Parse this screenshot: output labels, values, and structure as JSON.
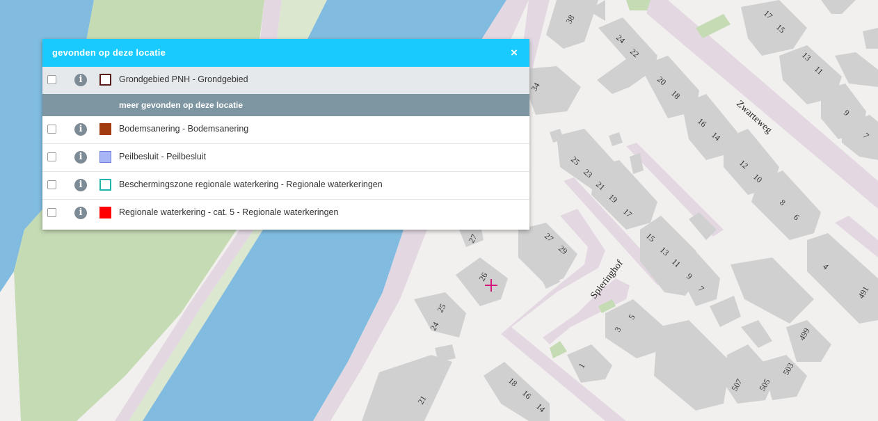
{
  "panel": {
    "title": "gevonden op deze locatie",
    "close_icon": "×",
    "primary": {
      "label": "Grondgebied PNH - Grondgebied",
      "swatch_fill": "#ffffff",
      "swatch_border": "#5a1a1a"
    },
    "more_header": "meer gevonden op deze locatie",
    "items": [
      {
        "label": "Bodemsanering - Bodemsanering",
        "swatch_fill": "#a23b10",
        "swatch_border": "#a23b10"
      },
      {
        "label": "Peilbesluit - Peilbesluit",
        "swatch_fill": "#a7b5f7",
        "swatch_border": "#6f80d8"
      },
      {
        "label": "Beschermingszone regionale waterkering - Regionale waterkeringen",
        "swatch_fill": "#ffffff",
        "swatch_border": "#1fb5ad"
      },
      {
        "label": "Regionale waterkering - cat. 5 - Regionale waterkeringen",
        "swatch_fill": "#ff0000",
        "swatch_border": "#ff0000"
      }
    ]
  },
  "map": {
    "streets": [
      "Zwarteweg",
      "Spieringhof"
    ],
    "house_numbers": [
      "38",
      "34",
      "24",
      "22",
      "20",
      "18",
      "16",
      "14",
      "12",
      "10",
      "8",
      "6",
      "4",
      "491",
      "17",
      "15",
      "13",
      "11",
      "9",
      "7",
      "25",
      "23",
      "21",
      "19",
      "17",
      "15",
      "13",
      "11",
      "9",
      "7",
      "27",
      "27",
      "29",
      "26",
      "25",
      "24",
      "3",
      "5",
      "1",
      "499",
      "503",
      "505",
      "507",
      "21",
      "18",
      "16",
      "14"
    ],
    "marker_icon": "crosshair-icon"
  }
}
